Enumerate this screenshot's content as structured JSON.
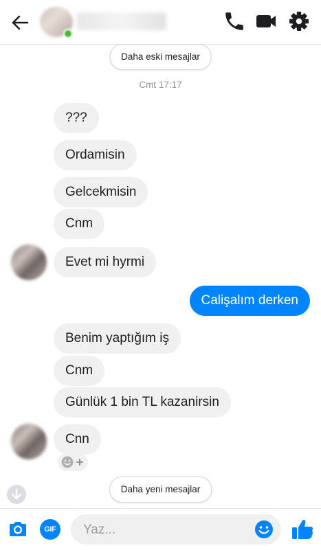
{
  "header": {
    "back_icon": "arrow-left-icon",
    "actions": [
      "phone-icon",
      "video-camera-icon",
      "gear-icon"
    ],
    "accent_color": "#0084ff"
  },
  "older_messages_label": "Daha eski mesajlar",
  "newer_messages_label": "Daha yeni mesajlar",
  "timestamp": "Cmt 17:17",
  "messages": [
    {
      "sender": "them",
      "text": "???"
    },
    {
      "sender": "them",
      "text": "Ordamisin"
    },
    {
      "sender": "them",
      "text": "Gelcekmisin"
    },
    {
      "sender": "them",
      "text": "Cnm"
    },
    {
      "sender": "them",
      "text": "Evet mi hyrmi"
    },
    {
      "sender": "me",
      "text": "Calişalım derken"
    },
    {
      "sender": "them",
      "text": "Benim yaptığım iş"
    },
    {
      "sender": "them",
      "text": "Cnm"
    },
    {
      "sender": "them",
      "text": "Günlük 1 bin TL kazanirsin"
    },
    {
      "sender": "them",
      "text": "Cnn"
    }
  ],
  "composer": {
    "placeholder": "Yaz...",
    "gif_label": "GIF",
    "icons": [
      "camera-icon",
      "gif-icon",
      "emoji-icon",
      "thumbs-up-icon"
    ]
  },
  "colors": {
    "outgoing_bubble": "#0084ff",
    "incoming_bubble": "#f1f0f0"
  }
}
